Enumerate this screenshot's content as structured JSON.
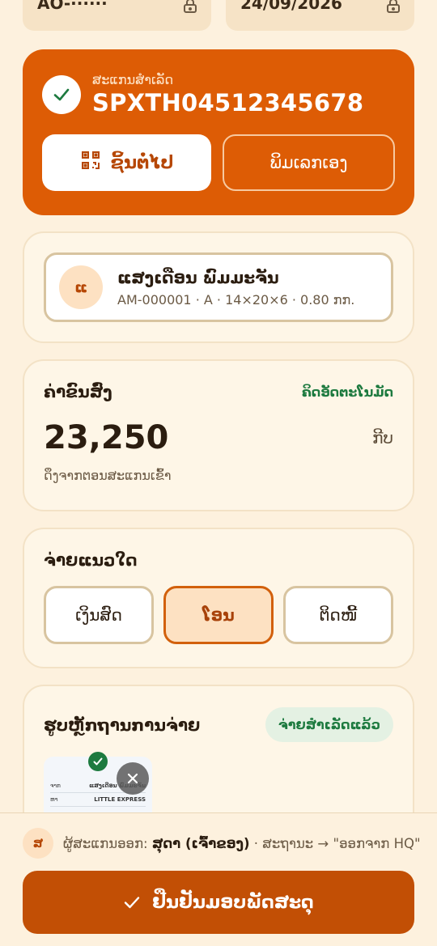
{
  "top_fields": {
    "left_value": "AO-······",
    "right_value": "24/09/2026"
  },
  "scan": {
    "label": "ສະແກນສຳເລັດ",
    "code": "SPXTH04512345678",
    "next_button": "ຊິ້ນຕໍ່ໄປ",
    "manual_button": "ພິມເລກເອງ"
  },
  "recipient": {
    "initial": "ແ",
    "name": "ແສງເດືອນ ພົມມະຈັນ",
    "meta": "AM-000001 · A · 14×20×6 · 0.80 ກກ."
  },
  "amount": {
    "title": "ຄ່າຂົນສົ່ງ",
    "auto_label": "ຄິດອັດຕະໂນມັດ",
    "value": "23,250",
    "unit": "ກີບ",
    "note": "ດຶງຈາກຕອນສະແກນເຂົ້າ"
  },
  "payment": {
    "title": "ຈ່າຍແນວໃດ",
    "options": [
      "ເງິນສົດ",
      "ໂອນ",
      "ຕິດໜີ້"
    ],
    "selected": "ໂອນ"
  },
  "proof": {
    "title": "ຮູບຫຼັກຖານການຈ່າຍ",
    "badge": "ຈ່າຍສຳເລັດແລ້ວ",
    "thumb": {
      "row1_label": "ຈາກ",
      "row1_value": "ແສງເດືອນ ພົມມະຈັນ",
      "row2_label": "ຫາ",
      "row2_value": "LITTLE EXPRESS"
    }
  },
  "footer": {
    "scanner_initial": "ສ",
    "scanner_prefix": "ຜູ້ສະແກນອອກ:",
    "scanner_name": "ສຸດາ (ເຈົ້າຂອງ)",
    "status_text": "· ສະຖານະ → \"ອອກຈາກ HQ\"",
    "confirm_button": "ຢືນຢັນມອບພັດສະດຸ"
  },
  "colors": {
    "brand": "#dd5c05",
    "success": "#1d7a3f",
    "background": "#fdf1de"
  }
}
